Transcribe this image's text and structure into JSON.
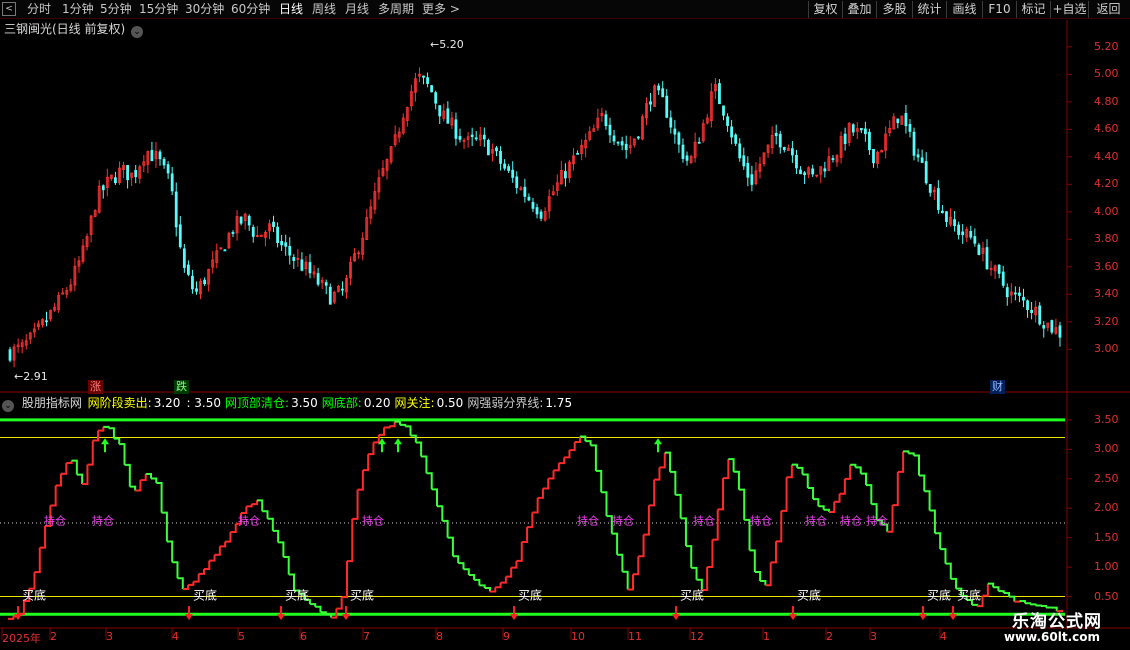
{
  "toolbar": {
    "back_icon": "back-arrow-icon",
    "periods": [
      "分时",
      "1分钟",
      "5分钟",
      "15分钟",
      "30分钟",
      "60分钟",
      "日线",
      "周线",
      "月线",
      "多周期",
      "更多 >"
    ],
    "active_period": "日线",
    "right_buttons": [
      "复权",
      "叠加",
      "多股",
      "统计",
      "画线",
      "F10",
      "标记",
      "+自选",
      "返回"
    ]
  },
  "main_chart": {
    "title": "三钢闽光(日线 前复权)",
    "price_ticks": [
      "5.20",
      "5.00",
      "4.80",
      "4.60",
      "4.40",
      "4.20",
      "4.00",
      "3.80",
      "3.60",
      "3.40",
      "3.20",
      "3.00"
    ],
    "high_marker": "5.20",
    "low_marker": "2.91",
    "tags": [
      "涨",
      "跌",
      "财"
    ],
    "colors": {
      "up": "#ff3232",
      "down": "#54fcfc",
      "axis": "#e03030",
      "grid": "#7a0000"
    }
  },
  "indicator": {
    "name": "股朋指标网",
    "items": [
      {
        "label": "网阶段卖出:",
        "value": "3.20",
        "color": "#ffff00"
      },
      {
        "label": "",
        "value": ": 3.50",
        "color": "#ff4040"
      },
      {
        "label": "网顶部清仓:",
        "value": "3.50",
        "color": "#00ff00"
      },
      {
        "label": "网底部:",
        "value": "0.20",
        "color": "#00ff00"
      },
      {
        "label": "网关注:",
        "value": "0.50",
        "color": "#ffff00"
      },
      {
        "label": "网强弱分界线:",
        "value": "1.75",
        "color": "#c8c8c8"
      }
    ],
    "ticks": [
      "3.50",
      "3.00",
      "2.50",
      "2.00",
      "1.50",
      "1.00",
      "0.50"
    ],
    "buy_label": "买底",
    "hold_label": "持仓"
  },
  "date_axis": [
    "2025年",
    "2",
    "3",
    "4",
    "5",
    "6",
    "7",
    "8",
    "9",
    "10",
    "11",
    "12",
    "1",
    "2",
    "3",
    "4"
  ],
  "watermark": {
    "line1": "乐淘公式网",
    "line2": "www.60lt.com"
  },
  "chart_data": {
    "type": "line",
    "series": [
      {
        "values": [
          2.98,
          3.01,
          3.1,
          3.22,
          3.35,
          3.5,
          3.72,
          4.1,
          4.22,
          4.3,
          4.26,
          4.45,
          4.38,
          4.2,
          3.6,
          3.4,
          3.55,
          3.7,
          3.88,
          3.95,
          3.82,
          3.88,
          3.75,
          3.66,
          3.58,
          3.48,
          3.38,
          3.42,
          3.7,
          3.95,
          4.25,
          4.45,
          4.78,
          4.98,
          4.9,
          4.7,
          4.6,
          4.5,
          4.52,
          4.45,
          4.32,
          4.2,
          4.1,
          4.0,
          4.15,
          4.3,
          4.42,
          4.55,
          4.7,
          4.55,
          4.45,
          4.62,
          4.88,
          4.78,
          4.5,
          4.35,
          4.6,
          4.9,
          4.7,
          4.4,
          4.22,
          4.4,
          4.55,
          4.48,
          4.32,
          4.25,
          4.35,
          4.45,
          4.6,
          4.55,
          4.4,
          4.55,
          4.72,
          4.5,
          4.3,
          4.1,
          3.92,
          3.85,
          3.8,
          3.65,
          3.52,
          3.4,
          3.35,
          3.28,
          3.18,
          3.12
        ]
      },
      {
        "values": [
          0.12,
          0.25,
          0.8,
          1.7,
          2.5,
          2.85,
          2.4,
          3.3,
          3.4,
          3.05,
          2.2,
          2.6,
          2.4,
          1.2,
          0.6,
          0.75,
          1.05,
          1.3,
          1.6,
          2.0,
          2.15,
          1.8,
          1.35,
          0.6,
          0.45,
          0.3,
          0.1,
          0.5,
          2.2,
          2.9,
          3.3,
          3.45,
          3.4,
          3.1,
          2.4,
          1.8,
          1.1,
          0.9,
          0.7,
          0.6,
          0.8,
          1.1,
          1.8,
          2.3,
          2.65,
          2.9,
          3.25,
          3.05,
          2.1,
          1.3,
          0.6,
          1.3,
          2.4,
          2.95,
          2.1,
          1.0,
          0.6,
          1.7,
          2.9,
          2.3,
          1.0,
          0.6,
          1.5,
          2.8,
          2.6,
          2.1,
          1.9,
          2.2,
          2.8,
          2.5,
          1.8,
          1.6,
          2.95,
          2.9,
          2.2,
          1.4,
          0.8,
          0.5,
          0.3,
          0.7,
          0.6,
          0.45,
          0.4,
          0.35,
          0.3,
          0.25
        ]
      }
    ],
    "ylim_price": [
      2.9,
      5.25
    ],
    "ylim_indicator": [
      0,
      3.6
    ],
    "reference_lines": [
      3.5,
      3.2,
      1.75,
      0.5,
      0.2
    ]
  }
}
